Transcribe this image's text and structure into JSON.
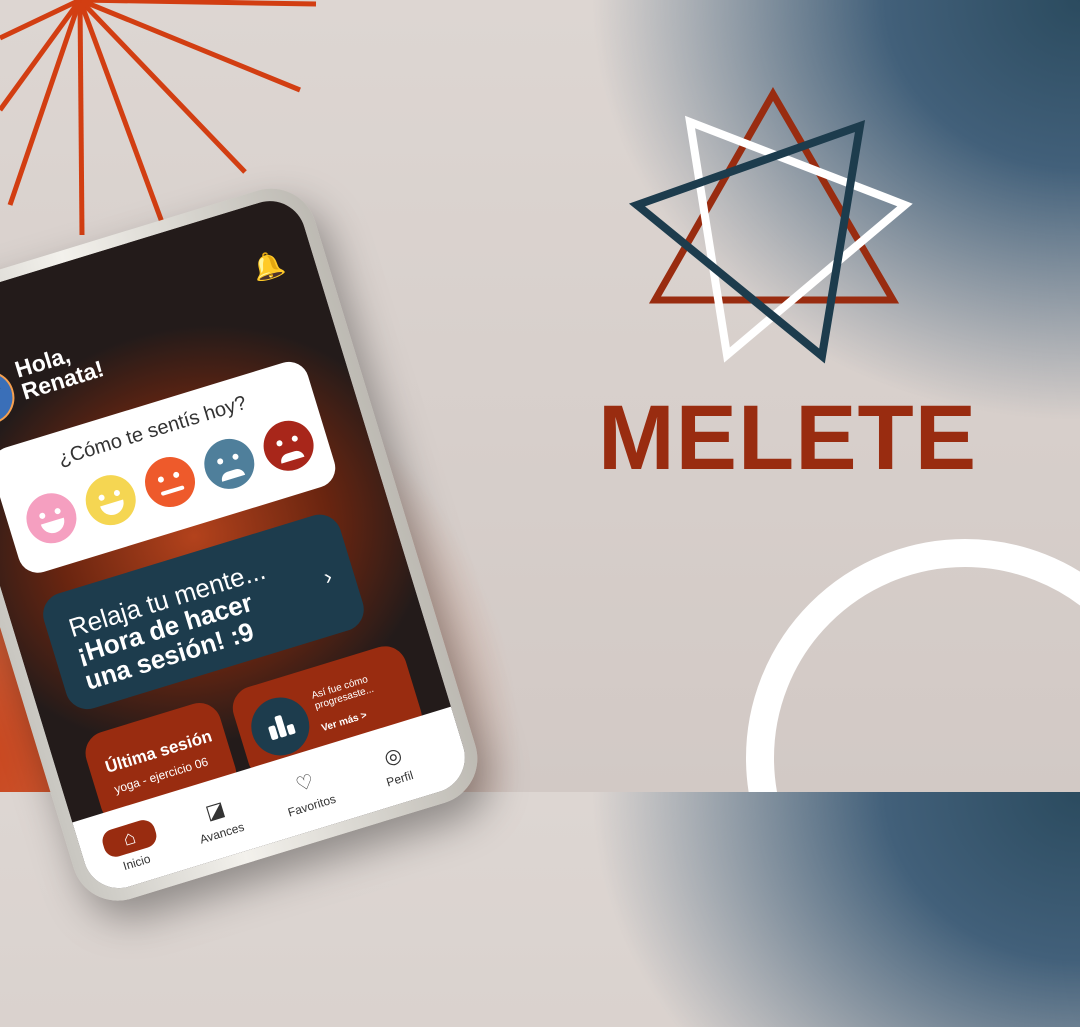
{
  "brand": {
    "name": "MELETE"
  },
  "app": {
    "greeting_line1": "Hola,",
    "greeting_line2": "Renata!",
    "mood": {
      "question": "¿Cómo te sentís hoy?",
      "faces": [
        {
          "name": "laughing-face-icon",
          "color": "#f59fc0"
        },
        {
          "name": "smiling-face-icon",
          "color": "#f5d652"
        },
        {
          "name": "neutral-face-icon",
          "color": "#ee5a2b"
        },
        {
          "name": "sad-face-icon",
          "color": "#4f7f9b"
        },
        {
          "name": "angry-face-icon",
          "color": "#a8261a"
        }
      ]
    },
    "session_card": {
      "line1": "Relaja tu mente...",
      "line2": "¡Hora de hacer",
      "line3": "una sesión! :9"
    },
    "last_session": {
      "title": "Última sesión",
      "subtitle": "yoga - ejercicio 06"
    },
    "progress": {
      "line1": "Así fue cómo",
      "line2": "progresaste...",
      "link": "Ver más >"
    },
    "nav": [
      {
        "label": "Inicio",
        "icon": "home-icon"
      },
      {
        "label": "Avances",
        "icon": "chart-icon"
      },
      {
        "label": "Favoritos",
        "icon": "heart-icon"
      },
      {
        "label": "Perfil",
        "icon": "profile-icon"
      }
    ]
  },
  "colors": {
    "brand_red": "#992c10",
    "navy": "#1d3c4d",
    "orange": "#d44018"
  }
}
